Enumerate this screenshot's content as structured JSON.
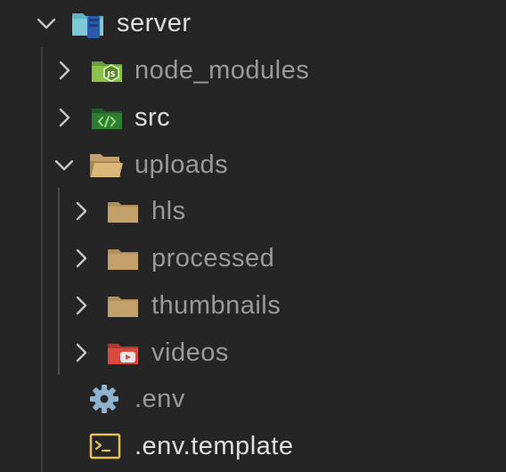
{
  "explorer": {
    "root": {
      "label": "server",
      "expanded": true,
      "icon": "server-folder-icon",
      "label_color": "#e0e0e0"
    },
    "items": [
      {
        "label": "node_modules",
        "type": "folder",
        "expanded": false,
        "icon": "nodejs-folder-icon",
        "label_color": "#9a9a9a"
      },
      {
        "label": "src",
        "type": "folder",
        "expanded": false,
        "icon": "source-code-folder-icon",
        "label_color": "#e0e0e0"
      },
      {
        "label": "uploads",
        "type": "folder",
        "expanded": true,
        "icon": "open-folder-icon",
        "label_color": "#9a9a9a",
        "children": [
          {
            "label": "hls",
            "type": "folder",
            "expanded": false,
            "icon": "folder-icon",
            "label_color": "#9a9a9a"
          },
          {
            "label": "processed",
            "type": "folder",
            "expanded": false,
            "icon": "folder-icon",
            "label_color": "#9a9a9a"
          },
          {
            "label": "thumbnails",
            "type": "folder",
            "expanded": false,
            "icon": "folder-icon",
            "label_color": "#9a9a9a"
          },
          {
            "label": "videos",
            "type": "folder",
            "expanded": false,
            "icon": "video-folder-icon",
            "label_color": "#9a9a9a"
          }
        ]
      },
      {
        "label": ".env",
        "type": "file",
        "icon": "gear-icon",
        "label_color": "#9a9a9a"
      },
      {
        "label": ".env.template",
        "type": "file",
        "icon": "terminal-file-icon",
        "label_color": "#e0e0e0"
      }
    ]
  },
  "colors": {
    "background": "#252526",
    "folder": "#c4a06a",
    "node_green": "#8bc34a",
    "src_green": "#2e7d32",
    "video_red": "#d84a3e",
    "gear_blue": "#8fb3cf",
    "terminal_yellow": "#e5c05a"
  }
}
